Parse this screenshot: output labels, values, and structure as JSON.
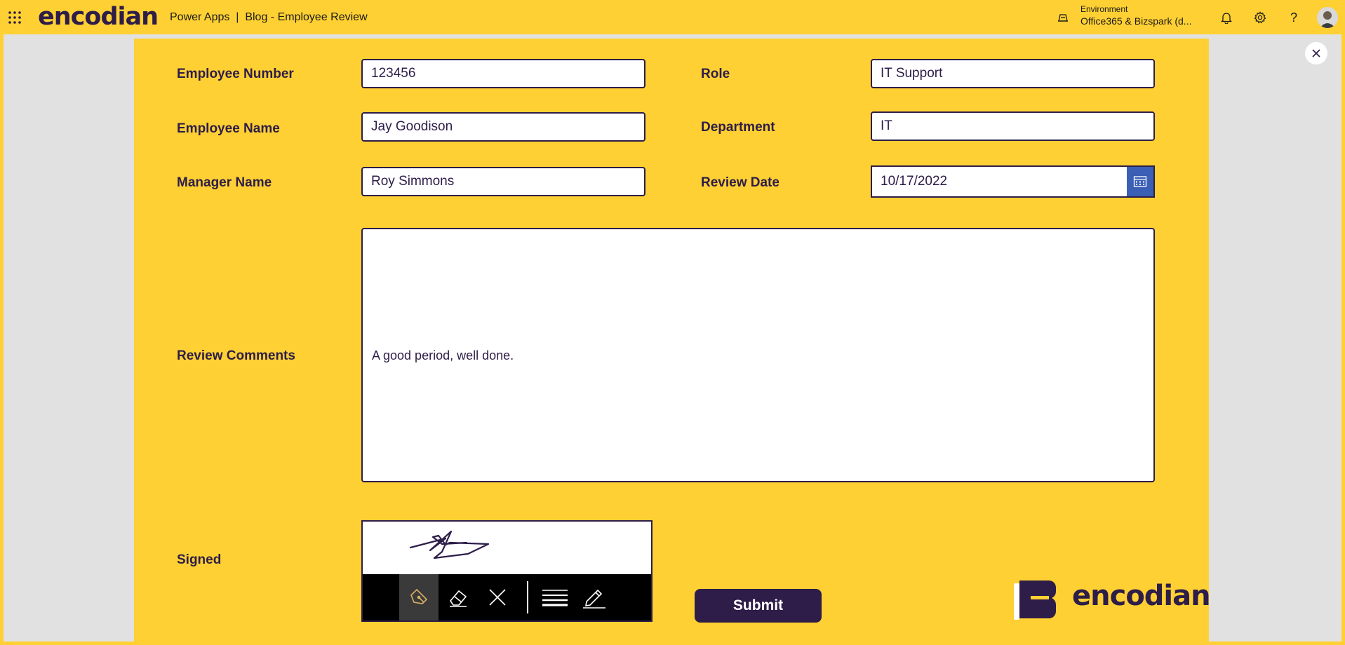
{
  "header": {
    "brand": "encodian",
    "app_name": "Power Apps  |  Blog - Employee Review",
    "environment_label": "Environment",
    "environment_value": "Office365 & Bizspark (d..."
  },
  "form": {
    "employee_number": {
      "label": "Employee Number",
      "value": "123456"
    },
    "employee_name": {
      "label": "Employee Name",
      "value": "Jay Goodison"
    },
    "manager_name": {
      "label": "Manager Name",
      "value": "Roy Simmons"
    },
    "role": {
      "label": "Role",
      "value": "IT Support"
    },
    "department": {
      "label": "Department",
      "value": "IT"
    },
    "review_date": {
      "label": "Review Date",
      "value": "10/17/2022"
    },
    "review_comments": {
      "label": "Review Comments",
      "value": "A good period, well done."
    },
    "signed": {
      "label": "Signed"
    },
    "submit_label": "Submit"
  },
  "footer_logo": "encodian",
  "colors": {
    "background": "#ffd033",
    "brand_purple": "#2d1d48",
    "calendar_blue": "#3a5fb5"
  }
}
